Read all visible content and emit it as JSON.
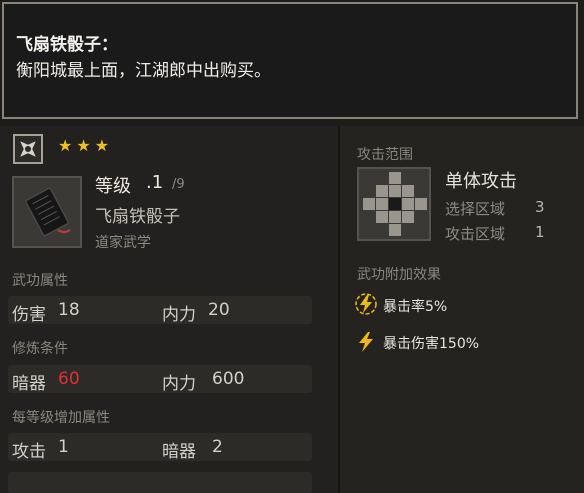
{
  "tooltip": {
    "title": "飞扇铁骰子：",
    "body": "衡阳城最上面，江湖郎中出购买。"
  },
  "item": {
    "stars": "★★★",
    "level_label": "等级",
    "level_value": ".1",
    "level_max": "/9",
    "name": "飞扇铁骰子",
    "school": "道家武学"
  },
  "attributes": {
    "header": "武功属性",
    "damage_label": "伤害",
    "damage_value": "18",
    "mp_label": "内力",
    "mp_value": "20"
  },
  "requirements": {
    "header": "修炼条件",
    "hidden_weapon_label": "暗器",
    "hidden_weapon_value": "60",
    "mp_label": "内力",
    "mp_value": "600"
  },
  "per_level": {
    "header": "每等级增加属性",
    "attack_label": "攻击",
    "attack_value": "1",
    "hidden_weapon_label": "暗器",
    "hidden_weapon_value": "2"
  },
  "attack_range": {
    "header": "攻击范围",
    "type": "单体攻击",
    "select_area_label": "选择区域",
    "select_area_value": "3",
    "attack_area_label": "攻击区域",
    "attack_area_value": "1"
  },
  "bonus": {
    "header": "武功附加效果",
    "crit_rate": "暴击率5%",
    "crit_damage": "暴击伤害150%"
  },
  "colors": {
    "star": "#f0c020",
    "requirement_unmet": "#e03030",
    "lightning": "#f0b818"
  }
}
